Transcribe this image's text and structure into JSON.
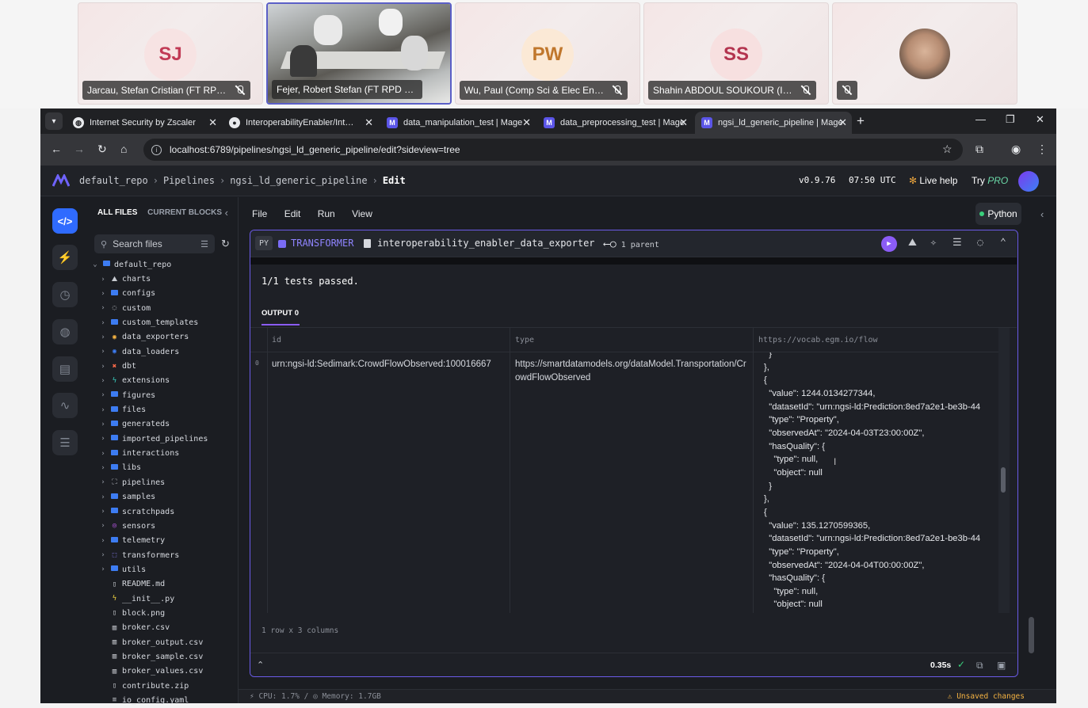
{
  "meeting": {
    "participants": [
      {
        "initials": "SJ",
        "name": "Jarcau, Stefan Cristian (FT RPD ...",
        "color": "#c13a55",
        "avatar_bg": "#f7e3e3"
      },
      {
        "initials": "",
        "name": "Fejer, Robert Stefan (FT RPD DAI C...",
        "color": "",
        "avatar_bg": ""
      },
      {
        "initials": "PW",
        "name": "Wu, Paul (Comp Sci & Elec Eng...",
        "color": "#c0772d",
        "avatar_bg": "#fbe9d6"
      },
      {
        "initials": "SS",
        "name": "Shahin ABDOUL SOUKOUR (Inr...",
        "color": "#b3344f",
        "avatar_bg": "#f7e0e0"
      },
      {
        "initials": "",
        "name": "",
        "color": "",
        "avatar_bg": ""
      }
    ]
  },
  "browser": {
    "tabs": [
      {
        "title": "Internet Security by Zscaler",
        "icon": "zscaler-icon"
      },
      {
        "title": "InteroperabilityEnabler/Interop",
        "icon": "github-icon"
      },
      {
        "title": "data_manipulation_test | Mage",
        "icon": "mage-icon"
      },
      {
        "title": "data_preprocessing_test | Mage",
        "icon": "mage-icon"
      },
      {
        "title": "ngsi_ld_generic_pipeline | Mage",
        "icon": "mage-icon"
      }
    ],
    "url": "localhost:6789/pipelines/ngsi_ld_generic_pipeline/edit?sideview=tree"
  },
  "header": {
    "breadcrumb": [
      "default_repo",
      "Pipelines",
      "ngsi_ld_generic_pipeline",
      "Edit"
    ],
    "version": "v0.9.76",
    "time": "07:50 UTC",
    "live_help": "Live help",
    "try": "Try",
    "pro": "PRO"
  },
  "filepanel": {
    "tab_all": "ALL FILES",
    "tab_current": "CURRENT BLOCKS",
    "search_placeholder": "Search files",
    "root": "default_repo",
    "items": [
      {
        "name": "charts",
        "kind": "chart"
      },
      {
        "name": "configs",
        "kind": "folder"
      },
      {
        "name": "custom",
        "kind": "custom"
      },
      {
        "name": "custom_templates",
        "kind": "folder"
      },
      {
        "name": "data_exporters",
        "kind": "exporter"
      },
      {
        "name": "data_loaders",
        "kind": "loader"
      },
      {
        "name": "dbt",
        "kind": "dbt"
      },
      {
        "name": "extensions",
        "kind": "extension"
      },
      {
        "name": "figures",
        "kind": "folder"
      },
      {
        "name": "files",
        "kind": "folder"
      },
      {
        "name": "generateds",
        "kind": "folder"
      },
      {
        "name": "imported_pipelines",
        "kind": "folder"
      },
      {
        "name": "interactions",
        "kind": "folder"
      },
      {
        "name": "libs",
        "kind": "folder"
      },
      {
        "name": "pipelines",
        "kind": "pipeline"
      },
      {
        "name": "samples",
        "kind": "folder"
      },
      {
        "name": "scratchpads",
        "kind": "folder"
      },
      {
        "name": "sensors",
        "kind": "sensor"
      },
      {
        "name": "telemetry",
        "kind": "folder"
      },
      {
        "name": "transformers",
        "kind": "transformer"
      },
      {
        "name": "utils",
        "kind": "folder"
      },
      {
        "name": "README.md",
        "kind": "file"
      },
      {
        "name": "__init__.py",
        "kind": "py"
      },
      {
        "name": "block.png",
        "kind": "file"
      },
      {
        "name": "broker.csv",
        "kind": "csv"
      },
      {
        "name": "broker_output.csv",
        "kind": "csv"
      },
      {
        "name": "broker_sample.csv",
        "kind": "csv"
      },
      {
        "name": "broker_values.csv",
        "kind": "csv"
      },
      {
        "name": "contribute.zip",
        "kind": "file"
      },
      {
        "name": "io_config.yaml",
        "kind": "yaml"
      }
    ]
  },
  "editor": {
    "menu": [
      "File",
      "Edit",
      "Run",
      "View"
    ],
    "language": "Python",
    "block": {
      "lang": "PY",
      "type": "TRANSFORMER",
      "name": "interoperability_enabler_data_exporter",
      "parents": "1 parent"
    },
    "tests_result": "1/1 tests passed.",
    "output_tab": "OUTPUT 0",
    "table": {
      "columns": [
        "id",
        "type",
        "https://vocab.egm.io/flow"
      ],
      "row_index": "0",
      "id_value": "urn:ngsi-ld:Sedimark:CrowdFlowObserved:100016667",
      "type_value": "https://smartdatamodels.org/dataModel.Transportation/CrowdFlowObserved",
      "flow_value": "  }\n},\n{\n  \"value\": 1244.0134277344,\n  \"datasetId\": \"urn:ngsi-ld:Prediction:8ed7a2e1-be3b-44\n  \"type\": \"Property\",\n  \"observedAt\": \"2024-04-03T23:00:00Z\",\n  \"hasQuality\": {\n    \"type\": null,\n    \"object\": null\n  }\n},\n{\n  \"value\": 135.1270599365,\n  \"datasetId\": \"urn:ngsi-ld:Prediction:8ed7a2e1-be3b-44\n  \"type\": \"Property\",\n  \"observedAt\": \"2024-04-04T00:00:00Z\",\n  \"hasQuality\": {\n    \"type\": null,\n    \"object\": null"
    },
    "rows_info": "1 row x 3 columns",
    "exec_time": "0.35s"
  },
  "status": {
    "cpu": "CPU: 1.7%",
    "memory": "Memory: 1.7GB",
    "unsaved": "Unsaved changes"
  }
}
